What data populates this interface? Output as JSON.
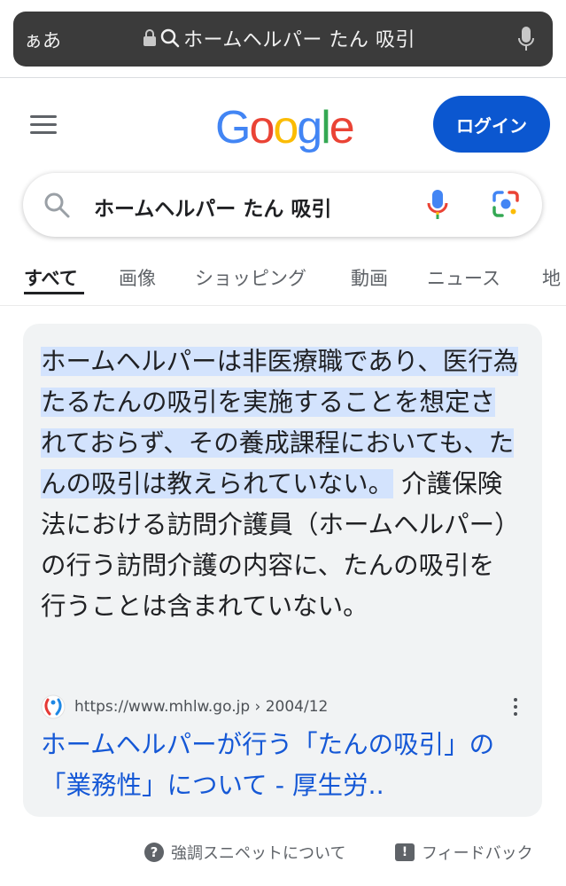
{
  "browser": {
    "aa_label": "ぁあ",
    "url_text": "ホームヘルパー たん 吸引"
  },
  "header": {
    "logo_text": "Google",
    "login_label": "ログイン"
  },
  "search": {
    "query": "ホームヘルパー たん 吸引"
  },
  "tabs": [
    "すべて",
    "画像",
    "ショッピング",
    "動画",
    "ニュース",
    "地"
  ],
  "snippet": {
    "highlighted": "ホームヘルパーは非医療職であり、医行為たるたんの吸引を実施することを想定されておらず、その養成課程においても、たんの吸引は教えられていない。",
    "rest": " 介護保険法における訪問介護員（ホームヘルパー）の行う訪問介護の内容に、たんの吸引を行うことは含まれていない。",
    "source_url": "https://www.mhlw.go.jp › 2004/12",
    "title": "ホームヘルパーが行う「たんの吸引」の「業務性」について - 厚生労.."
  },
  "footer": {
    "about_label": "強調スニペットについて",
    "feedback_label": "フィードバック"
  },
  "colors": {
    "login_bg": "#0b57d0",
    "link": "#1558d6",
    "highlight": "#d3e3fd"
  }
}
